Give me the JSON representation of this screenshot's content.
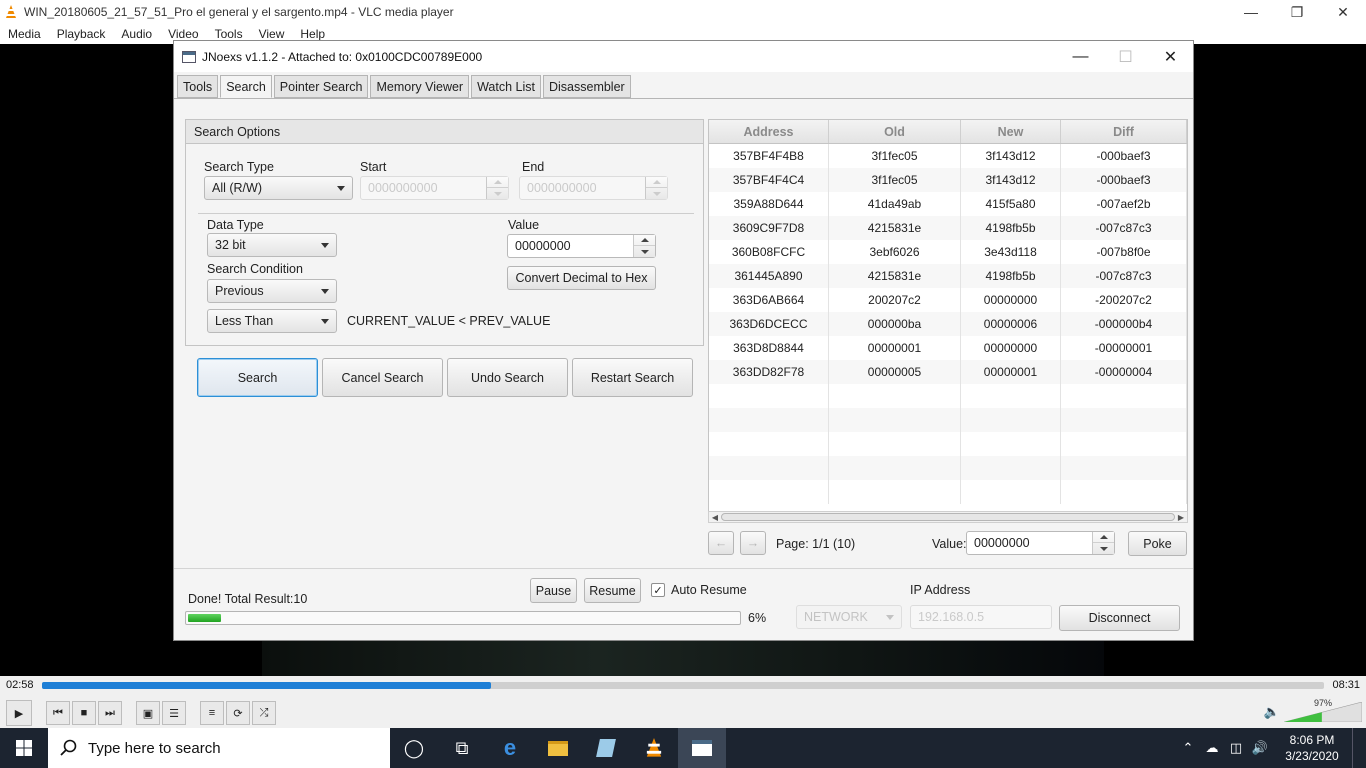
{
  "vlc": {
    "title": "WIN_20180605_21_57_51_Pro el general y el sargento.mp4 - VLC media player",
    "menu": [
      "Media",
      "Playback",
      "Audio",
      "Video",
      "Tools",
      "View",
      "Help"
    ],
    "time_elapsed": "02:58",
    "time_total": "08:31",
    "seek_progress_percent": 35,
    "volume": "97%"
  },
  "jnoexs": {
    "title": "JNoexs v1.1.2 - Attached to: 0x0100CDC00789E000",
    "tabs": [
      "Tools",
      "Search",
      "Pointer Search",
      "Memory Viewer",
      "Watch List",
      "Disassembler"
    ],
    "active_tab": "Search",
    "search_options": {
      "header": "Search Options",
      "search_type_label": "Search Type",
      "search_type_value": "All (R/W)",
      "start_label": "Start",
      "start_value": "0000000000",
      "end_label": "End",
      "end_value": "0000000000",
      "data_type_label": "Data Type",
      "data_type_value": "32 bit",
      "value_label": "Value",
      "value_value": "00000000",
      "convert_button": "Convert Decimal to Hex",
      "search_condition_label": "Search Condition",
      "search_condition_value": "Previous",
      "comparison_value": "Less Than",
      "condition_expression": "CURRENT_VALUE < PREV_VALUE"
    },
    "buttons": {
      "search": "Search",
      "cancel": "Cancel Search",
      "undo": "Undo Search",
      "restart": "Restart Search"
    },
    "results": {
      "columns": [
        "Address",
        "Old",
        "New",
        "Diff"
      ],
      "rows": [
        [
          "357BF4F4B8",
          "3f1fec05",
          "3f143d12",
          "-000baef3"
        ],
        [
          "357BF4F4C4",
          "3f1fec05",
          "3f143d12",
          "-000baef3"
        ],
        [
          "359A88D644",
          "41da49ab",
          "415f5a80",
          "-007aef2b"
        ],
        [
          "3609C9F7D8",
          "4215831e",
          "4198fb5b",
          "-007c87c3"
        ],
        [
          "360B08FCFC",
          "3ebf6026",
          "3e43d118",
          "-007b8f0e"
        ],
        [
          "361445A890",
          "4215831e",
          "4198fb5b",
          "-007c87c3"
        ],
        [
          "363D6AB664",
          "200207c2",
          "00000000",
          "-200207c2"
        ],
        [
          "363D6DCECC",
          "000000ba",
          "00000006",
          "-000000b4"
        ],
        [
          "363D8D8844",
          "00000001",
          "00000000",
          "-00000001"
        ],
        [
          "363DD82F78",
          "00000005",
          "00000001",
          "-00000004"
        ]
      ],
      "page_text": "Page: 1/1 (10)",
      "poke_value_label": "Value:",
      "poke_value": "00000000",
      "poke_button": "Poke"
    },
    "status": {
      "text": "Done! Total Result:10",
      "progress_percent": 6,
      "progress_text": "6%",
      "pause_button": "Pause",
      "resume_button": "Resume",
      "auto_resume_label": "Auto Resume",
      "auto_resume_checked": true,
      "ip_label": "IP Address",
      "network_value": "NETWORK",
      "ip_value": "192.168.0.5",
      "disconnect_button": "Disconnect"
    }
  },
  "taskbar": {
    "search_placeholder": "Type here to search",
    "time": "8:06 PM",
    "date": "3/23/2020"
  },
  "colors": {
    "taskbar": "#1c2430",
    "vlc_seek": "#1e7fd6",
    "progress_green": "#21a321",
    "focus_blue": "#2d8fd6"
  }
}
